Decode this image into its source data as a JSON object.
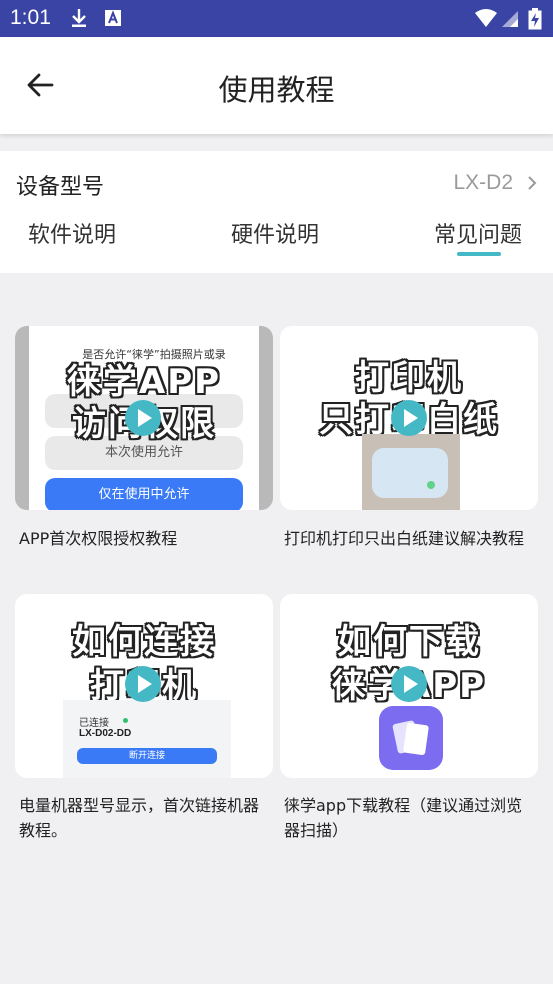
{
  "status_bar": {
    "time": "1:01",
    "background_color": "#3a44a4",
    "icons": [
      "download-icon",
      "font-app-icon",
      "wifi-icon",
      "signal-icon",
      "battery-charging-icon"
    ]
  },
  "app_bar": {
    "title": "使用教程",
    "back_icon": "arrow-left-icon"
  },
  "device": {
    "label": "设备型号",
    "value": "LX-D2",
    "chevron_icon": "chevron-right-icon"
  },
  "tabs": [
    {
      "label": "软件说明",
      "selected": false
    },
    {
      "label": "硬件说明",
      "selected": false
    },
    {
      "label": "常见问题",
      "selected": true
    }
  ],
  "accent_color": "#45b8c6",
  "videos": [
    {
      "caption": "APP首次权限授权教程",
      "thumb_lines": [
        "徕学APP",
        "访问权限"
      ],
      "thumb_small_text": "是否允许“徕学”拍摄照片或录",
      "thumb_buttons": [
        "本次使用允许",
        "仅在使用中允许"
      ]
    },
    {
      "caption": "打印机打印只出白纸建议解决教程",
      "thumb_lines": [
        "打印机",
        "只打印白纸"
      ]
    },
    {
      "caption": "电量机器型号显示，首次链接机器教程。",
      "thumb_lines": [
        "如何连接",
        "打印机"
      ],
      "thumb_status": "已连接",
      "thumb_device": "LX-D02-DD",
      "thumb_button": "断开连接"
    },
    {
      "caption": "徕学app下载教程（建议通过浏览器扫描）",
      "thumb_lines": [
        "如何下载",
        "徕学APP"
      ]
    }
  ]
}
